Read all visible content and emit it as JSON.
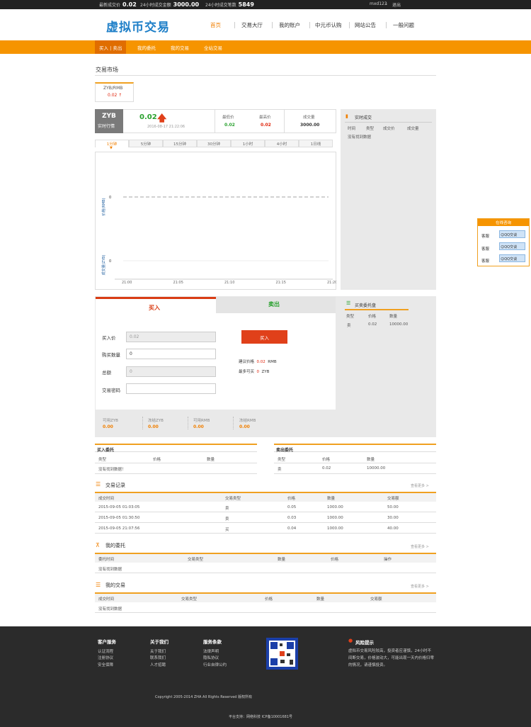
{
  "topbar": {
    "latest_label": "最新成交价",
    "latest_value": "0.02",
    "volume_label": "24小时成交金额",
    "volume_value": "3000.00",
    "count_label": "24小时成交笔数",
    "count_value": "5849",
    "user": "mxd123",
    "logout": "退出"
  },
  "logo": "虚拟币交易",
  "nav": [
    "首页",
    "交易大厅",
    "我的账户",
    "中元币认购",
    "网站公告",
    "一般问题"
  ],
  "subnav": [
    "买入 | 卖出",
    "我的委托",
    "我的交易",
    "全站交易"
  ],
  "market": {
    "title": "交易市场",
    "coin_name": "ZYB/RMB",
    "coin_price": "0.02 ↑"
  },
  "ticker": {
    "coin": "ZYB",
    "coin_sub": "实时行情",
    "price": "0.02",
    "time": "2016-08-17 21:22:06",
    "low_label": "最低价",
    "low_value": "0.02",
    "high_label": "最高价",
    "high_value": "0.02",
    "vol_label": "成交量",
    "vol_value": "3000.00"
  },
  "chart_tabs": [
    "1分钟",
    "5分钟",
    "15分钟",
    "30分钟",
    "1小时",
    "4小时",
    "1日线"
  ],
  "chart_data": {
    "type": "line",
    "x": [
      "21:00",
      "21:05",
      "21:10",
      "21:15",
      "21:20"
    ],
    "series": [
      {
        "name": "价格(RMB)",
        "values": [
          0,
          0,
          0,
          0,
          0
        ]
      },
      {
        "name": "成交量(ZYB)",
        "values": [
          0,
          0,
          0,
          0,
          0
        ]
      }
    ],
    "ylabel": "价格(RMB)",
    "ylabel2": "成交量(ZYB)",
    "ytick_price": "0",
    "ytick_vol": "0"
  },
  "realtime": {
    "title": "实时成交",
    "cols": [
      "时间",
      "类型",
      "成交价",
      "成交量"
    ],
    "empty": "没有找到数据"
  },
  "trade_form": {
    "buy_tab": "买入",
    "sell_tab": "卖出",
    "price_label": "买入价",
    "price_value": "0.02",
    "qty_label": "购买数量",
    "qty_value": "0",
    "total_label": "总额",
    "total_value": "0",
    "pwd_label": "交易密码",
    "pwd_value": "",
    "submit": "买入",
    "suggest_label": "建议价格",
    "suggest_value": "0.02",
    "suggest_unit": "RMB",
    "max_label": "最多可买",
    "max_value": "0",
    "max_unit": "ZYB"
  },
  "balances": [
    {
      "label": "可用ZYB",
      "value": "0.00"
    },
    {
      "label": "冻结ZYB",
      "value": "0.00"
    },
    {
      "label": "可用RMB",
      "value": "0.00"
    },
    {
      "label": "冻结RMB",
      "value": "0.00"
    }
  ],
  "orderbook": {
    "title": "买卖委托盘",
    "cols": [
      "类型",
      "价格",
      "数量"
    ],
    "rows": [
      {
        "type": "卖",
        "price": "0.02",
        "qty": "10000.00"
      }
    ]
  },
  "buy_orders": {
    "title": "买入委托",
    "cols": [
      "类型",
      "价格",
      "数量"
    ],
    "empty": "没有找到数据！"
  },
  "sell_orders": {
    "title": "卖出委托",
    "cols": [
      "类型",
      "价格",
      "数量"
    ],
    "rows": [
      {
        "type": "卖",
        "price": "0.02",
        "qty": "10000.00"
      }
    ]
  },
  "records": {
    "title": "交易记录",
    "more": "查看更多 >",
    "cols": [
      "成交时间",
      "交易类型",
      "价格",
      "数量",
      "交易额"
    ],
    "rows": [
      {
        "time": "2015-09-05 01:03:05",
        "type": "卖",
        "price": "0.05",
        "qty": "1000.00",
        "amount": "50.00"
      },
      {
        "time": "2015-09-05 01:30:50",
        "type": "卖",
        "price": "0.03",
        "qty": "1000.00",
        "amount": "30.00"
      },
      {
        "time": "2015-09-05 21:07:56",
        "type": "买",
        "price": "0.04",
        "qty": "1000.00",
        "amount": "40.00"
      }
    ]
  },
  "my_orders": {
    "title": "我的委托",
    "more": "查看更多 >",
    "cols": [
      "委托时间",
      "交易类型",
      "数量",
      "价格",
      "操作"
    ],
    "empty": "没有找到数据"
  },
  "my_trades": {
    "title": "我的交易",
    "more": "查看更多 >",
    "cols": [
      "成交时间",
      "交易类型",
      "价格",
      "数量",
      "交易额"
    ],
    "empty": "没有找到数据"
  },
  "qq_widget": {
    "title": "在线咨询",
    "rows": [
      {
        "label": "客服",
        "btn": "QQ交谈"
      },
      {
        "label": "客服",
        "btn": "QQ交谈"
      },
      {
        "label": "客服",
        "btn": "QQ交谈"
      }
    ]
  },
  "footer": {
    "col1_title": "客户服务",
    "col1": [
      "认证流程",
      "注册协议",
      "安全保障"
    ],
    "col2_title": "关于我们",
    "col2": [
      "关于我们",
      "联系我们",
      "人才招聘"
    ],
    "col3_title": "服务条款",
    "col3": [
      "法律声明",
      "隐私协议",
      "行业自律公约"
    ],
    "risk_title": "风险提示",
    "risk_text": "虚拟币交易风险较高，投资者应谨慎，24小时不间断交易，价格波动大，可能出现一天内价格归零的情况，请谨慎投资。",
    "copyright": "Copyright 2005-2014 ZHA All Rights Reserved 版权所有",
    "icp": "平台支持：网络科技 ICP备10001681号"
  },
  "colors": {
    "orange": "#f69400",
    "blue": "#1e7fc8",
    "green": "#29a12e",
    "red": "#e0240b",
    "footer": "#2b2b2b"
  }
}
